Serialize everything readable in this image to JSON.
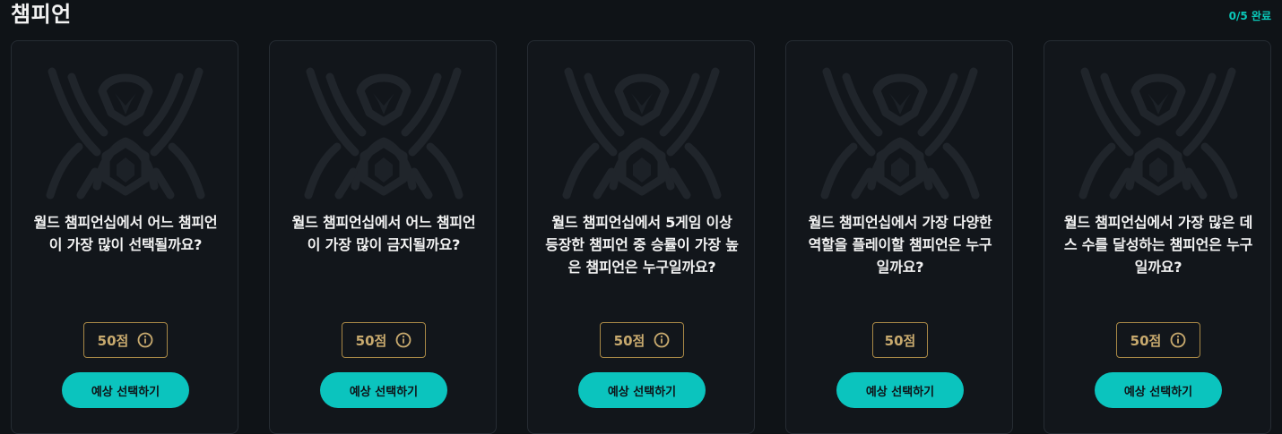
{
  "section": {
    "title": "챔피언",
    "progress": "0/5 완료"
  },
  "colors": {
    "accent": "#0ac8b9",
    "gold": "#c8aa6e",
    "background": "#0f1317"
  },
  "cards": [
    {
      "question": "월드 챔피언십에서 어느 챔피언이 가장 많이 선택될까요?",
      "points": "50점",
      "has_info": true,
      "button": "예상 선택하기",
      "emblem_icon": "worlds-trophy-emblem-icon"
    },
    {
      "question": "월드 챔피언십에서 어느 챔피언이 가장 많이 금지될까요?",
      "points": "50점",
      "has_info": true,
      "button": "예상 선택하기",
      "emblem_icon": "worlds-trophy-emblem-icon"
    },
    {
      "question": "월드 챔피언십에서 5게임 이상 등장한 챔피언 중 승률이 가장 높은 챔피언은 누구일까요?",
      "points": "50점",
      "has_info": true,
      "button": "예상 선택하기",
      "emblem_icon": "worlds-trophy-emblem-icon"
    },
    {
      "question": "월드 챔피언십에서 가장 다양한 역할을 플레이할 챔피언은 누구일까요?",
      "points": "50점",
      "has_info": false,
      "button": "예상 선택하기",
      "emblem_icon": "worlds-trophy-emblem-icon"
    },
    {
      "question": "월드 챔피언십에서 가장 많은 데스 수를 달성하는 챔피언은 누구일까요?",
      "points": "50점",
      "has_info": true,
      "button": "예상 선택하기",
      "emblem_icon": "worlds-trophy-emblem-icon"
    }
  ]
}
